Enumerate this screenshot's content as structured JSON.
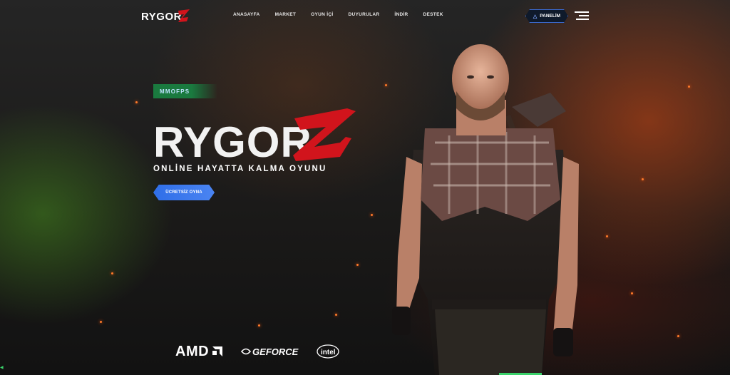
{
  "nav": {
    "logo_text": "RYGORZ",
    "links": [
      "ANASAYFA",
      "MARKET",
      "OYUN İÇİ",
      "DUYURULAR",
      "İNDİR",
      "DESTEK"
    ],
    "panel_button": "PANELİM",
    "panel_icon": "user-shield-icon",
    "menu_icon": "hamburger-menu-icon"
  },
  "hero": {
    "tag": "MMOFPS",
    "logo_text": "RYGORZ",
    "subtitle": "ONLİNE HAYATTA KALMA OYUNU",
    "play_button": "ÜCRETSİZ OYNA"
  },
  "sponsors": {
    "amd": "AMD",
    "geforce": "GEFORCE",
    "intel": "intel"
  },
  "colors": {
    "accent_blue": "#3a74ec",
    "tag_green": "#1a7a3f",
    "logo_red": "#d1141c"
  }
}
